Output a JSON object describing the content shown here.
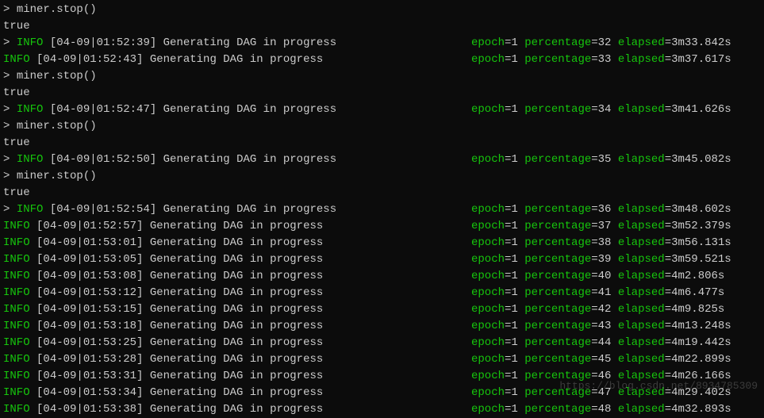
{
  "cmd_prompt": "> ",
  "cmd_text": "miner.stop()",
  "true_text": "true",
  "info_label": "INFO",
  "msg": "Generating DAG in progress",
  "epoch_key": "epoch",
  "epoch_val": "1",
  "pct_key": "percentage",
  "elapsed_key": "elapsed",
  "lines": [
    {
      "type": "cmd"
    },
    {
      "type": "true"
    },
    {
      "type": "log_indent",
      "ts": "[04-09|01:52:39]",
      "pct": "32",
      "elapsed": "3m33.842s"
    },
    {
      "type": "log",
      "ts": "[04-09|01:52:43]",
      "pct": "33",
      "elapsed": "3m37.617s"
    },
    {
      "type": "cmd"
    },
    {
      "type": "true"
    },
    {
      "type": "log_indent",
      "ts": "[04-09|01:52:47]",
      "pct": "34",
      "elapsed": "3m41.626s"
    },
    {
      "type": "cmd"
    },
    {
      "type": "true"
    },
    {
      "type": "log_indent",
      "ts": "[04-09|01:52:50]",
      "pct": "35",
      "elapsed": "3m45.082s"
    },
    {
      "type": "cmd"
    },
    {
      "type": "true"
    },
    {
      "type": "log_indent",
      "ts": "[04-09|01:52:54]",
      "pct": "36",
      "elapsed": "3m48.602s"
    },
    {
      "type": "log",
      "ts": "[04-09|01:52:57]",
      "pct": "37",
      "elapsed": "3m52.379s"
    },
    {
      "type": "log",
      "ts": "[04-09|01:53:01]",
      "pct": "38",
      "elapsed": "3m56.131s"
    },
    {
      "type": "log",
      "ts": "[04-09|01:53:05]",
      "pct": "39",
      "elapsed": "3m59.521s"
    },
    {
      "type": "log",
      "ts": "[04-09|01:53:08]",
      "pct": "40",
      "elapsed": "4m2.806s"
    },
    {
      "type": "log",
      "ts": "[04-09|01:53:12]",
      "pct": "41",
      "elapsed": "4m6.477s"
    },
    {
      "type": "log",
      "ts": "[04-09|01:53:15]",
      "pct": "42",
      "elapsed": "4m9.825s"
    },
    {
      "type": "log",
      "ts": "[04-09|01:53:18]",
      "pct": "43",
      "elapsed": "4m13.248s"
    },
    {
      "type": "log",
      "ts": "[04-09|01:53:25]",
      "pct": "44",
      "elapsed": "4m19.442s"
    },
    {
      "type": "log",
      "ts": "[04-09|01:53:28]",
      "pct": "45",
      "elapsed": "4m22.899s"
    },
    {
      "type": "log",
      "ts": "[04-09|01:53:31]",
      "pct": "46",
      "elapsed": "4m26.166s"
    },
    {
      "type": "log",
      "ts": "[04-09|01:53:34]",
      "pct": "47",
      "elapsed": "4m29.402s"
    },
    {
      "type": "log_last",
      "ts": "[04-09|01:53:38]",
      "pct": "48",
      "elapsed": "4m32.893s"
    }
  ],
  "watermark": "https://blog.csdn.net/8934785309"
}
